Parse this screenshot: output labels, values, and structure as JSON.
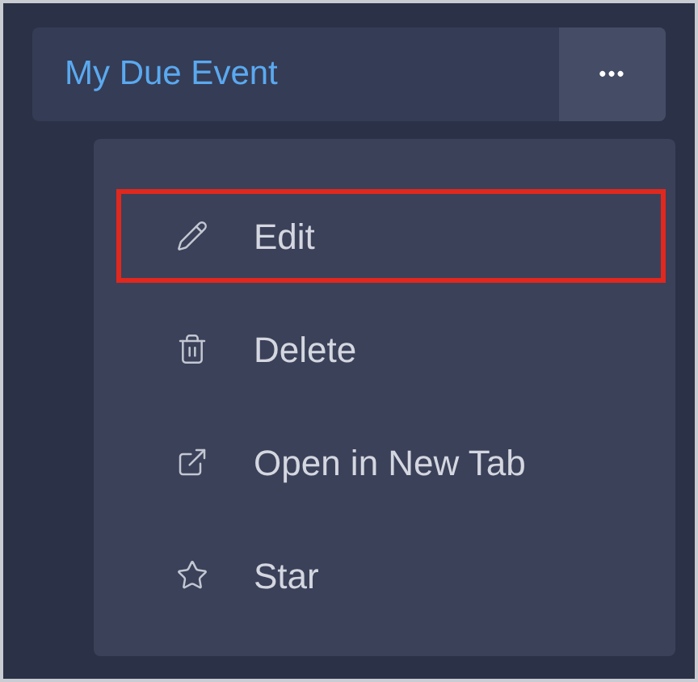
{
  "header": {
    "title": "My Due Event",
    "menu_button": "•••"
  },
  "menu": {
    "items": [
      {
        "kind": "edit",
        "label": "Edit",
        "highlighted": true
      },
      {
        "kind": "delete",
        "label": "Delete",
        "highlighted": false
      },
      {
        "kind": "open",
        "label": "Open in New Tab",
        "highlighted": false
      },
      {
        "kind": "star",
        "label": "Star",
        "highlighted": false
      }
    ]
  }
}
